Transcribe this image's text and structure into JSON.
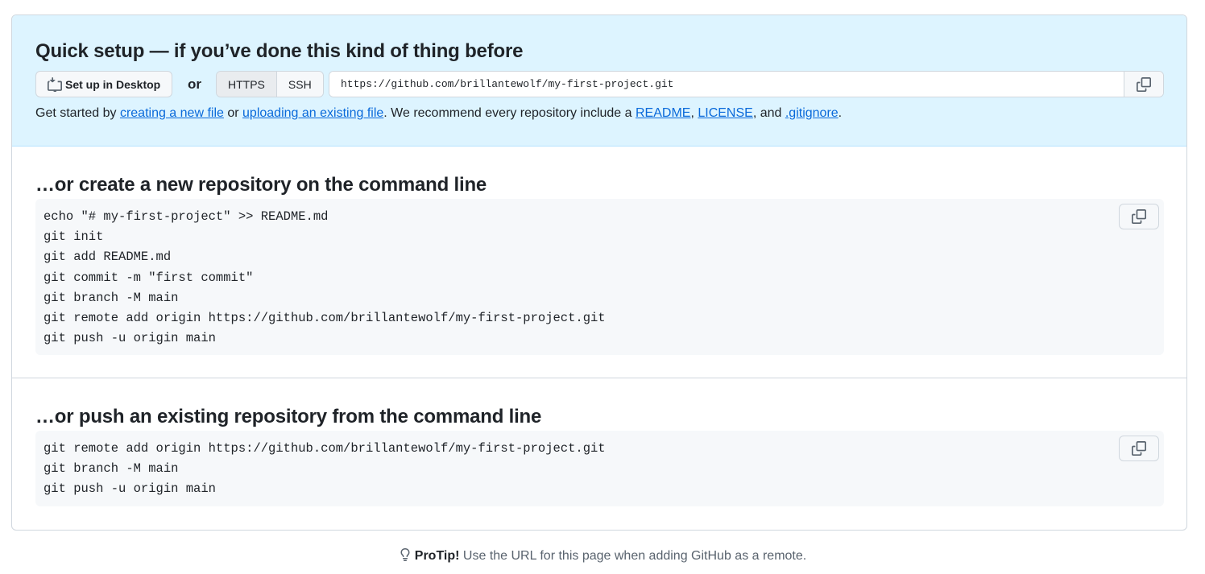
{
  "quick_setup": {
    "title": "Quick setup — if you’ve done this kind of thing before",
    "desktop_button": "Set up in Desktop",
    "or": "or",
    "protocols": [
      "HTTPS",
      "SSH"
    ],
    "selected_protocol": "HTTPS",
    "url": "https://github.com/brillantewolf/my-first-project.git",
    "desc": {
      "part1": "Get started by ",
      "link1": "creating a new file",
      "part2": " or ",
      "link2": "uploading an existing file",
      "part3": ". We recommend every repository include a ",
      "link3": "README",
      "sep1": ", ",
      "link4": "LICENSE",
      "sep2": ", and ",
      "link5": ".gitignore",
      "end": "."
    }
  },
  "new_repo": {
    "title": "…or create a new repository on the command line",
    "lines": [
      "echo \"# my-first-project\" >> README.md",
      "git init",
      "git add README.md",
      "git commit -m \"first commit\"",
      "git branch -M main",
      "git remote add origin https://github.com/brillantewolf/my-first-project.git",
      "git push -u origin main"
    ]
  },
  "push_repo": {
    "title": "…or push an existing repository from the command line",
    "lines": [
      "git remote add origin https://github.com/brillantewolf/my-first-project.git",
      "git branch -M main",
      "git push -u origin main"
    ]
  },
  "protip": {
    "label": "ProTip!",
    "text": " Use the URL for this page when adding GitHub as a remote."
  },
  "icons": {
    "desktop": "desktop-download-icon",
    "copy": "copy-icon",
    "light_bulb": "light-bulb-icon"
  },
  "colors": {
    "link": "#0969da",
    "quick_bg": "#ddf4ff",
    "code_bg": "#f6f8fa",
    "border": "#d0d7de"
  }
}
